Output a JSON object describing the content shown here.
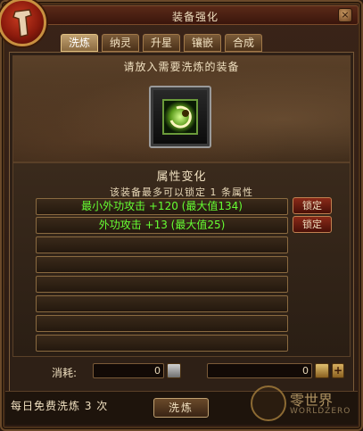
{
  "window": {
    "title": "装备强化",
    "close_label": "×"
  },
  "tabs": [
    {
      "label": "洗炼",
      "active": true
    },
    {
      "label": "纳灵",
      "active": false
    },
    {
      "label": "升星",
      "active": false
    },
    {
      "label": "镶嵌",
      "active": false
    },
    {
      "label": "合成",
      "active": false
    }
  ],
  "upper": {
    "prompt": "请放入需要洗炼的装备",
    "slot_item_icon": "ring-icon"
  },
  "attributes": {
    "title": "属性变化",
    "lock_note": "该装备最多可以锁定 1 条属性",
    "rows": [
      {
        "text": "最小外功攻击 +120 (最大值134)",
        "lock_label": "锁定"
      },
      {
        "text": "外功攻击 +13 (最大值25)",
        "lock_label": "锁定"
      },
      {
        "text": ""
      },
      {
        "text": ""
      },
      {
        "text": ""
      },
      {
        "text": ""
      },
      {
        "text": ""
      },
      {
        "text": ""
      },
      {
        "text": ""
      }
    ]
  },
  "consume": {
    "label": "消耗:",
    "left_value": "0",
    "right_value": "0",
    "plus_label": "+"
  },
  "bottom": {
    "free_text": "每日免费洗炼 3 次",
    "wash_label": "洗炼"
  },
  "watermark": {
    "name": "零世界",
    "sub": "WORLDZERO"
  },
  "colors": {
    "attr_green": "#66ff33",
    "title_red": "#5a2a18"
  }
}
